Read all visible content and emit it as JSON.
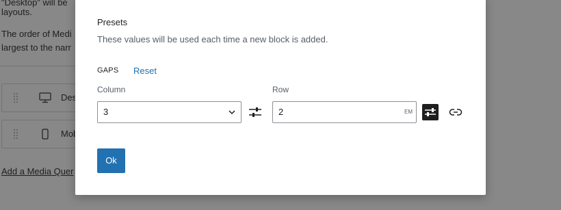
{
  "background": {
    "text_line_1": "\"Desktop\" will be",
    "text_line_2": "layouts.",
    "text_line_3": "The order of Medi",
    "text_line_4": "largest to the narr",
    "items": [
      {
        "label": "Des",
        "icon": "desktop-icon"
      },
      {
        "label": "Mob",
        "icon": "mobile-icon"
      }
    ],
    "link": "Add a Media Quer"
  },
  "modal": {
    "title": "Presets",
    "description": "These values will be used each time a new block is added.",
    "gaps_label": "GAPS",
    "reset_label": "Reset",
    "column_label": "Column",
    "column_value": "3",
    "row_label": "Row",
    "row_value": "2",
    "row_unit": "EM",
    "ok_label": "Ok"
  },
  "colors": {
    "overlay": "#888888",
    "accent": "#2271b1",
    "text": "#1e1e1e",
    "muted": "#555d66"
  }
}
